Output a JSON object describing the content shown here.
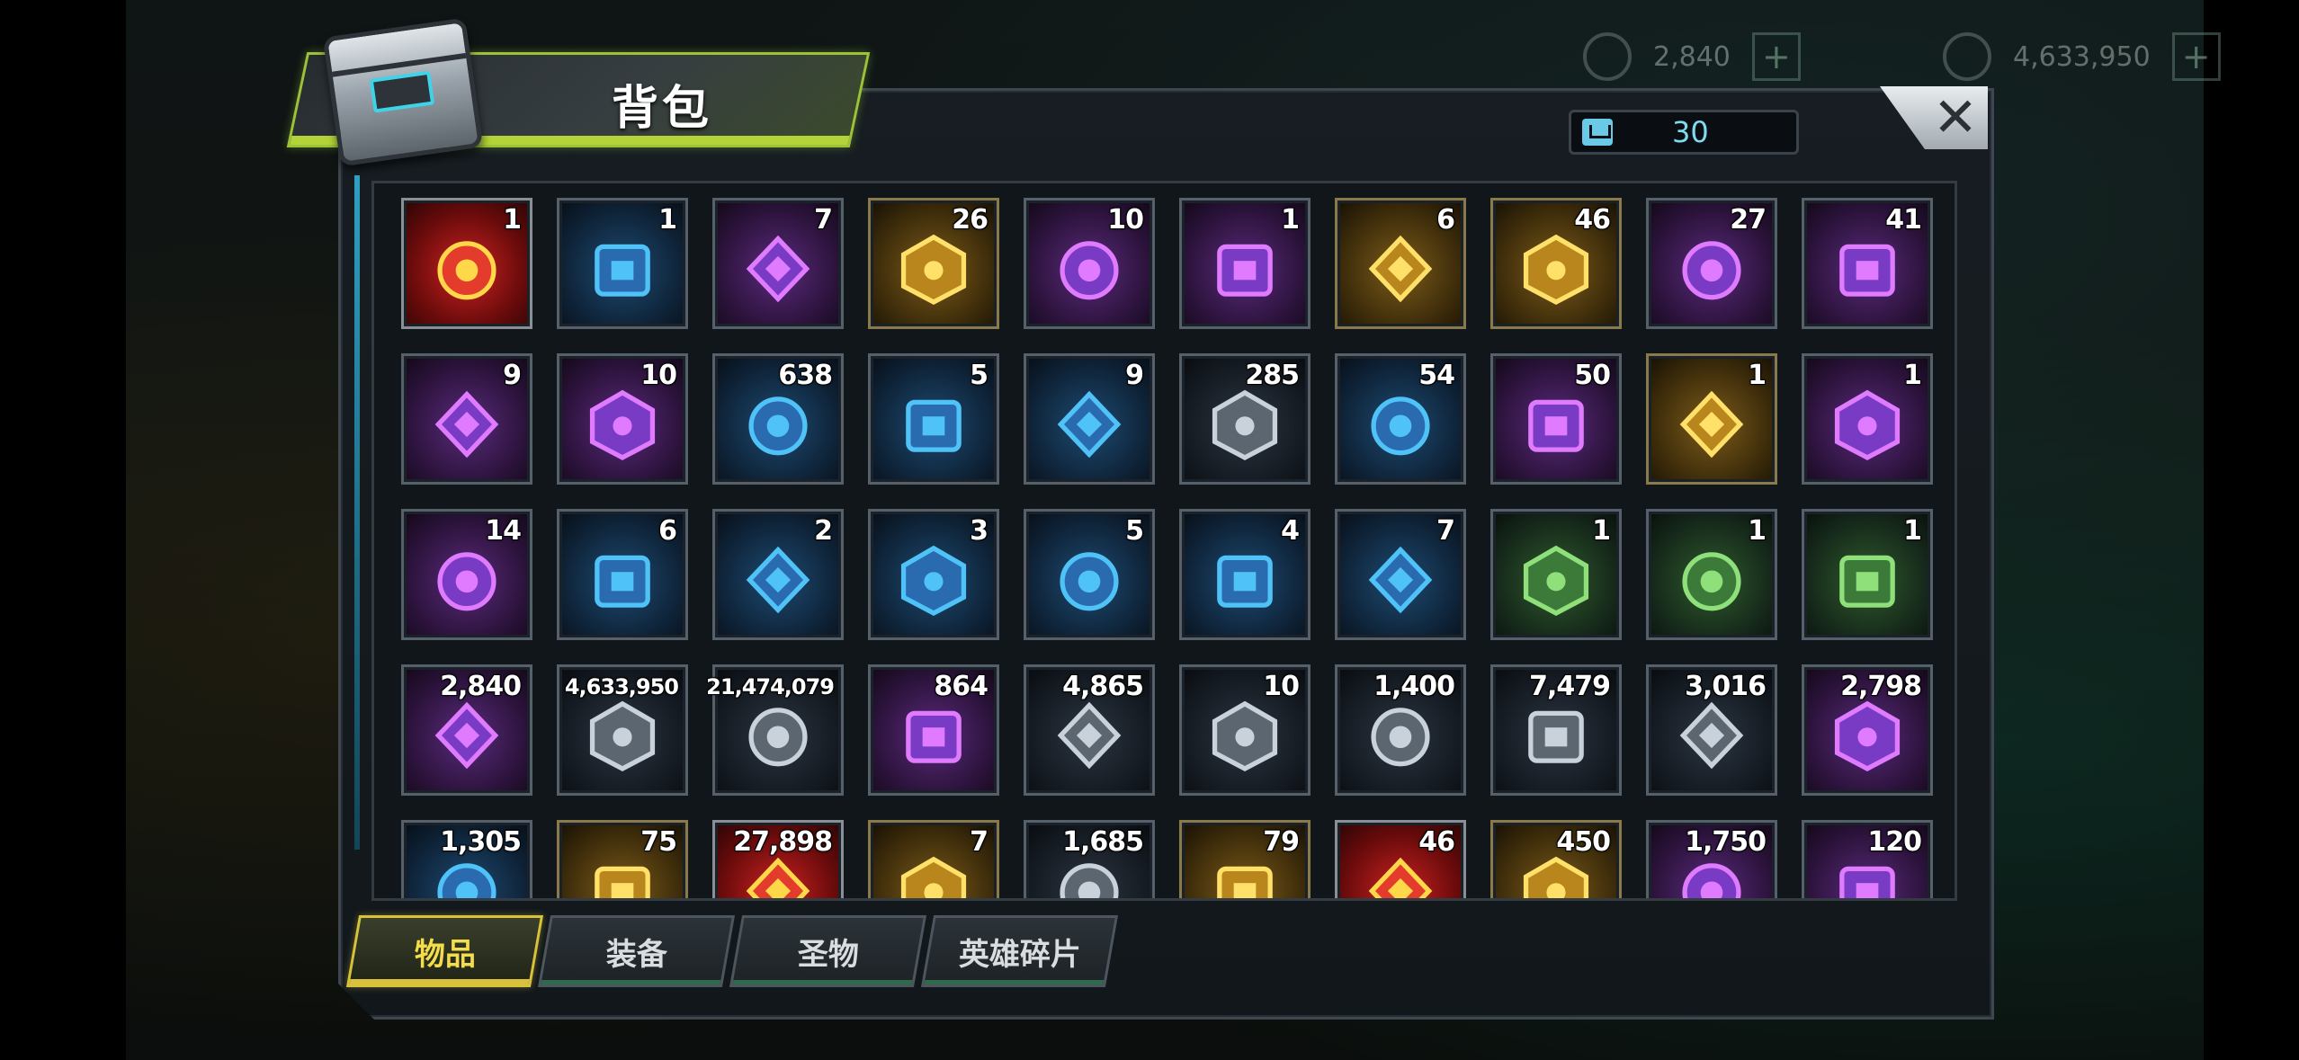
{
  "hud": {
    "gems": "2,840",
    "gold": "4,633,950",
    "plus_label": "+"
  },
  "window": {
    "title": "背包",
    "capacity": "30",
    "close_label": "✕"
  },
  "items": [
    {
      "count": "1",
      "icon": "sss-chest-icon",
      "rarity": "r-red"
    },
    {
      "count": "1",
      "icon": "s-chest-icon",
      "rarity": "r-blue"
    },
    {
      "count": "7",
      "icon": "microphone-icon",
      "rarity": "r-purple"
    },
    {
      "count": "26",
      "icon": "gold-24h-card-icon",
      "rarity": "r-gold"
    },
    {
      "count": "10",
      "icon": "speed-12h-card-icon",
      "rarity": "r-purple"
    },
    {
      "count": "1",
      "icon": "gold-12h-card-icon",
      "rarity": "r-purple"
    },
    {
      "count": "6",
      "icon": "lips-candy-icon",
      "rarity": "r-gold"
    },
    {
      "count": "46",
      "icon": "golden-skull-icon",
      "rarity": "r-gold"
    },
    {
      "count": "27",
      "icon": "film-reel-icon",
      "rarity": "r-purple"
    },
    {
      "count": "41",
      "icon": "pink-bottle-cap-icon",
      "rarity": "r-purple"
    },
    {
      "count": "9",
      "icon": "spade-chip-icon",
      "rarity": "r-purple"
    },
    {
      "count": "10",
      "icon": "police-badge-icon",
      "rarity": "r-purple"
    },
    {
      "count": "638",
      "icon": "cinema-ticket-icon",
      "rarity": "r-blue"
    },
    {
      "count": "5",
      "icon": "timer-token-icon",
      "rarity": "r-blue"
    },
    {
      "count": "9",
      "icon": "blue-bottle-cap-icon",
      "rarity": "r-blue"
    },
    {
      "count": "285",
      "icon": "red-poker-chip-icon",
      "rarity": "r-dark"
    },
    {
      "count": "54",
      "icon": "bullet-icon",
      "rarity": "r-blue"
    },
    {
      "count": "50",
      "icon": "s04-medal-icon",
      "rarity": "r-purple"
    },
    {
      "count": "1",
      "icon": "gold-hat-blueprint-icon",
      "rarity": "r-gold"
    },
    {
      "count": "1",
      "icon": "purple-shirt-blueprint-icon",
      "rarity": "r-purple"
    },
    {
      "count": "14",
      "icon": "purple-shirt-blueprint-icon",
      "rarity": "r-purple"
    },
    {
      "count": "6",
      "icon": "blue-revolver-blueprint-icon",
      "rarity": "r-blue"
    },
    {
      "count": "2",
      "icon": "blue-hat-blueprint-icon",
      "rarity": "r-blue"
    },
    {
      "count": "3",
      "icon": "blue-swords-blueprint-icon",
      "rarity": "r-blue"
    },
    {
      "count": "5",
      "icon": "blue-accessory-blueprint-icon",
      "rarity": "r-blue"
    },
    {
      "count": "4",
      "icon": "blue-boots-blueprint-icon",
      "rarity": "r-blue"
    },
    {
      "count": "7",
      "icon": "blue-shirt-blueprint-icon",
      "rarity": "r-blue"
    },
    {
      "count": "1",
      "icon": "green-boots-blueprint-icon",
      "rarity": "r-green"
    },
    {
      "count": "1",
      "icon": "green-accessory-blueprint-icon",
      "rarity": "r-green"
    },
    {
      "count": "1",
      "icon": "green-shirt-blueprint-icon",
      "rarity": "r-green"
    },
    {
      "count": "2,840",
      "icon": "purple-gem-icon",
      "rarity": "r-purple"
    },
    {
      "count": "4,633,950",
      "icon": "gold-coins-icon",
      "rarity": "r-dark",
      "small": true
    },
    {
      "count": "21,474,079",
      "icon": "green-battery-icon",
      "rarity": "r-dark",
      "small": true
    },
    {
      "count": "864",
      "icon": "purple-orb-icon",
      "rarity": "r-purple"
    },
    {
      "count": "4,865",
      "icon": "gear-icon",
      "rarity": "r-dark"
    },
    {
      "count": "10",
      "icon": "red-network-token-icon",
      "rarity": "r-dark"
    },
    {
      "count": "1,400",
      "icon": "eye-crest-icon",
      "rarity": "r-dark"
    },
    {
      "count": "7,479",
      "icon": "crystal-prism-icon",
      "rarity": "r-dark"
    },
    {
      "count": "3,016",
      "icon": "golden-fist-icon",
      "rarity": "r-dark"
    },
    {
      "count": "2,798",
      "icon": "puzzle-piece-icon",
      "rarity": "r-purple"
    },
    {
      "count": "1,305",
      "icon": "crest-medal-icon",
      "rarity": "r-blue"
    },
    {
      "count": "75",
      "icon": "gold-crest-icon",
      "rarity": "r-gold"
    },
    {
      "count": "27,898",
      "icon": "red-emblem-icon",
      "rarity": "r-red"
    },
    {
      "count": "7",
      "icon": "orange-crystal-icon",
      "rarity": "r-gold"
    },
    {
      "count": "1,685",
      "icon": "pink-flower-icon",
      "rarity": "r-dark"
    },
    {
      "count": "79",
      "icon": "gold-shield-icon",
      "rarity": "r-gold"
    },
    {
      "count": "46",
      "icon": "red-target-icon",
      "rarity": "r-red"
    },
    {
      "count": "450",
      "icon": "potion-icon",
      "rarity": "r-gold"
    },
    {
      "count": "1,750",
      "icon": "purple-crest-icon",
      "rarity": "r-purple"
    },
    {
      "count": "120",
      "icon": "dna-icon",
      "rarity": "r-purple"
    }
  ],
  "tabs": [
    {
      "label": "物品",
      "active": true
    },
    {
      "label": "装备",
      "active": false
    },
    {
      "label": "圣物",
      "active": false
    },
    {
      "label": "英雄碎片",
      "active": false
    }
  ],
  "colors": {
    "accent_green": "#b3d339",
    "accent_gold": "#d8c23c",
    "capacity_text": "#7ddcf0"
  }
}
